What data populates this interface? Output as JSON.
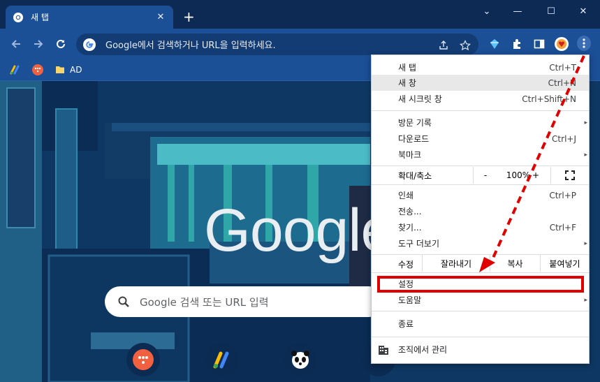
{
  "tab": {
    "title": "새 탭",
    "close_glyph": "✕"
  },
  "tabstrip": {
    "newtab_glyph": "+",
    "chevron": "⌄",
    "minimize": "—",
    "maximize": "☐",
    "close": "✕"
  },
  "omnibox": {
    "placeholder": "Google에서 검색하거나 URL을 입력하세요."
  },
  "bookmarks": [
    {
      "label": ""
    },
    {
      "label": ""
    },
    {
      "label": "AD"
    }
  ],
  "page": {
    "logo": "Google",
    "search_placeholder": "Google 검색 또는 URL 입력"
  },
  "menu": {
    "items": [
      {
        "label": "새 탭",
        "shortcut": "Ctrl+T"
      },
      {
        "label": "새 창",
        "shortcut": "Ctrl+N"
      },
      {
        "label": "새 시크릿 창",
        "shortcut": "Ctrl+Shift+N"
      },
      {
        "label": "방문 기록",
        "shortcut": ""
      },
      {
        "label": "다운로드",
        "shortcut": "Ctrl+J"
      },
      {
        "label": "북마크",
        "shortcut": ""
      },
      {
        "label": "인쇄",
        "shortcut": "Ctrl+P"
      },
      {
        "label": "전송...",
        "shortcut": ""
      },
      {
        "label": "찾기...",
        "shortcut": "Ctrl+F"
      },
      {
        "label": "도구 더보기",
        "shortcut": ""
      },
      {
        "label": "설정",
        "shortcut": ""
      },
      {
        "label": "도움말",
        "shortcut": ""
      },
      {
        "label": "종료",
        "shortcut": ""
      },
      {
        "label": "조직에서 관리",
        "shortcut": ""
      }
    ],
    "zoom": {
      "label": "확대/축소",
      "minus": "-",
      "value": "100%",
      "plus": "+"
    },
    "edit": {
      "label": "수정",
      "cut": "잘라내기",
      "copy": "복사",
      "paste": "붙여넣기"
    },
    "submenu_arrow": "▸"
  },
  "colors": {
    "tabstrip": "#0d2a55",
    "toolbar": "#1b4f96",
    "annotation": "#e00000"
  }
}
